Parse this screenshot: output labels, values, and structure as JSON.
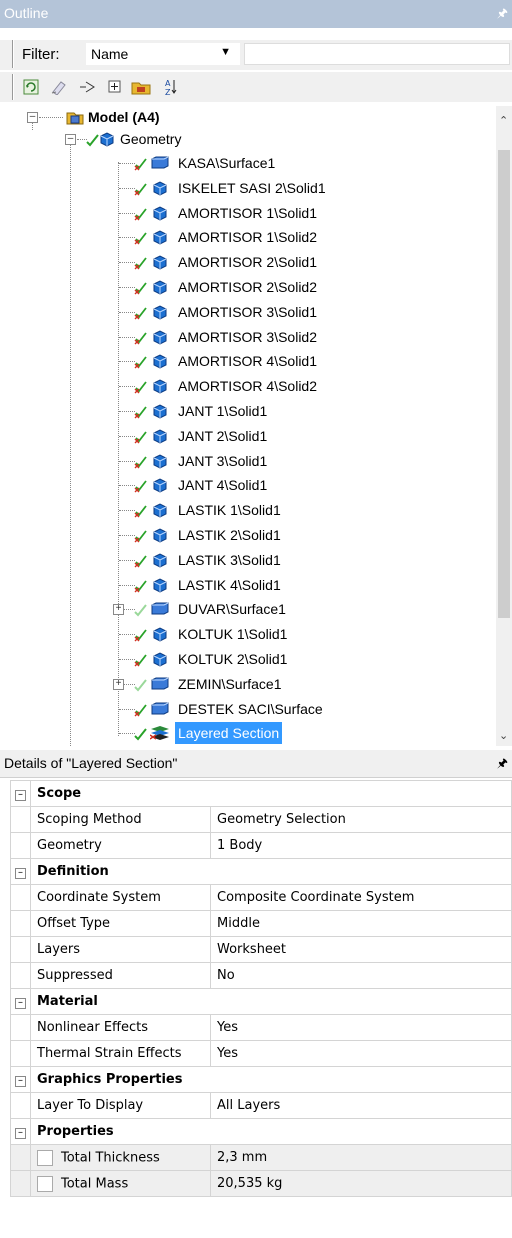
{
  "outline": {
    "title": "Outline",
    "filter_label": "Filter:",
    "filter_value": "Name",
    "filter_text": ""
  },
  "tree": {
    "root": "Model (A4)",
    "geometry": "Geometry",
    "items": [
      "KASA\\Surface1",
      "ISKELET SASI 2\\Solid1",
      "AMORTISOR 1\\Solid1",
      "AMORTISOR 1\\Solid2",
      "AMORTISOR 2\\Solid1",
      "AMORTISOR 2\\Solid2",
      "AMORTISOR 3\\Solid1",
      "AMORTISOR 3\\Solid2",
      "AMORTISOR 4\\Solid1",
      "AMORTISOR 4\\Solid2",
      "JANT 1\\Solid1",
      "JANT 2\\Solid1",
      "JANT 3\\Solid1",
      "JANT 4\\Solid1",
      "LASTIK 1\\Solid1",
      "LASTIK 2\\Solid1",
      "LASTIK 3\\Solid1",
      "LASTIK 4\\Solid1",
      "DUVAR\\Surface1",
      "KOLTUK 1\\Solid1",
      "KOLTUK 2\\Solid1",
      "ZEMIN\\Surface1",
      "DESTEK SACI\\Surface",
      "Layered Section"
    ]
  },
  "details": {
    "title": "Details of \"Layered Section\"",
    "groups": {
      "scope": {
        "title": "Scope",
        "scoping_method_name": "Scoping Method",
        "scoping_method_value": "Geometry Selection",
        "geometry_name": "Geometry",
        "geometry_value": "1 Body"
      },
      "definition": {
        "title": "Definition",
        "coord_name": "Coordinate System",
        "coord_value": "Composite Coordinate System",
        "offset_name": "Offset Type",
        "offset_value": "Middle",
        "layers_name": "Layers",
        "layers_value": "Worksheet",
        "suppressed_name": "Suppressed",
        "suppressed_value": "No"
      },
      "material": {
        "title": "Material",
        "nonlinear_name": "Nonlinear Effects",
        "nonlinear_value": "Yes",
        "thermal_name": "Thermal Strain Effects",
        "thermal_value": "Yes"
      },
      "graphics": {
        "title": "Graphics Properties",
        "layer_name": "Layer To Display",
        "layer_value": "All Layers"
      },
      "properties": {
        "title": "Properties",
        "thickness_name": "Total Thickness",
        "thickness_value": "2,3 mm",
        "mass_name": "Total Mass",
        "mass_value": "20,535 kg"
      }
    }
  },
  "colors": {
    "header_bg": "#b4c4d8",
    "selection": "#3399ff",
    "check_green": "#2aa32a",
    "cross_red": "#d03020",
    "body_blue": "#1c6fd0"
  }
}
